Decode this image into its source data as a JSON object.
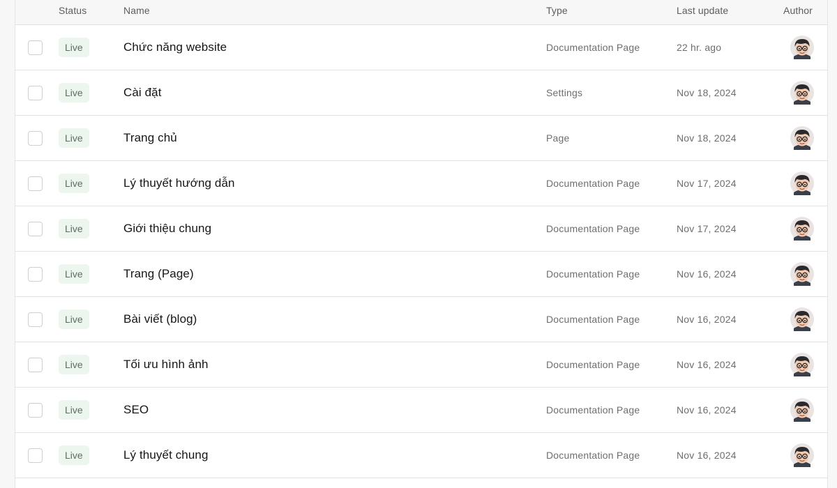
{
  "table": {
    "columns": {
      "status": "Status",
      "name": "Name",
      "type": "Type",
      "last_update": "Last update",
      "author": "Author"
    },
    "rows": [
      {
        "status": "Live",
        "name": "Chức năng website",
        "type": "Documentation Page",
        "last_update": "22 hr. ago",
        "author_icon": "avatar-icon"
      },
      {
        "status": "Live",
        "name": "Cài đặt",
        "type": "Settings",
        "last_update": "Nov 18, 2024",
        "author_icon": "avatar-icon"
      },
      {
        "status": "Live",
        "name": "Trang chủ",
        "type": "Page",
        "last_update": "Nov 18, 2024",
        "author_icon": "avatar-icon"
      },
      {
        "status": "Live",
        "name": "Lý thuyết hướng dẫn",
        "type": "Documentation Page",
        "last_update": "Nov 17, 2024",
        "author_icon": "avatar-icon"
      },
      {
        "status": "Live",
        "name": "Giới thiệu chung",
        "type": "Documentation Page",
        "last_update": "Nov 17, 2024",
        "author_icon": "avatar-icon"
      },
      {
        "status": "Live",
        "name": "Trang (Page)",
        "type": "Documentation Page",
        "last_update": "Nov 16, 2024",
        "author_icon": "avatar-icon"
      },
      {
        "status": "Live",
        "name": "Bài viết (blog)",
        "type": "Documentation Page",
        "last_update": "Nov 16, 2024",
        "author_icon": "avatar-icon"
      },
      {
        "status": "Live",
        "name": "Tối ưu hình ảnh",
        "type": "Documentation Page",
        "last_update": "Nov 16, 2024",
        "author_icon": "avatar-icon"
      },
      {
        "status": "Live",
        "name": "SEO",
        "type": "Documentation Page",
        "last_update": "Nov 16, 2024",
        "author_icon": "avatar-icon"
      },
      {
        "status": "Live",
        "name": "Lý thuyết chung",
        "type": "Documentation Page",
        "last_update": "Nov 16, 2024",
        "author_icon": "avatar-icon"
      }
    ]
  },
  "colors": {
    "live_badge_bg": "#ecf6ee",
    "live_badge_text": "#5c6e61",
    "divider": "#e2e2e2"
  }
}
